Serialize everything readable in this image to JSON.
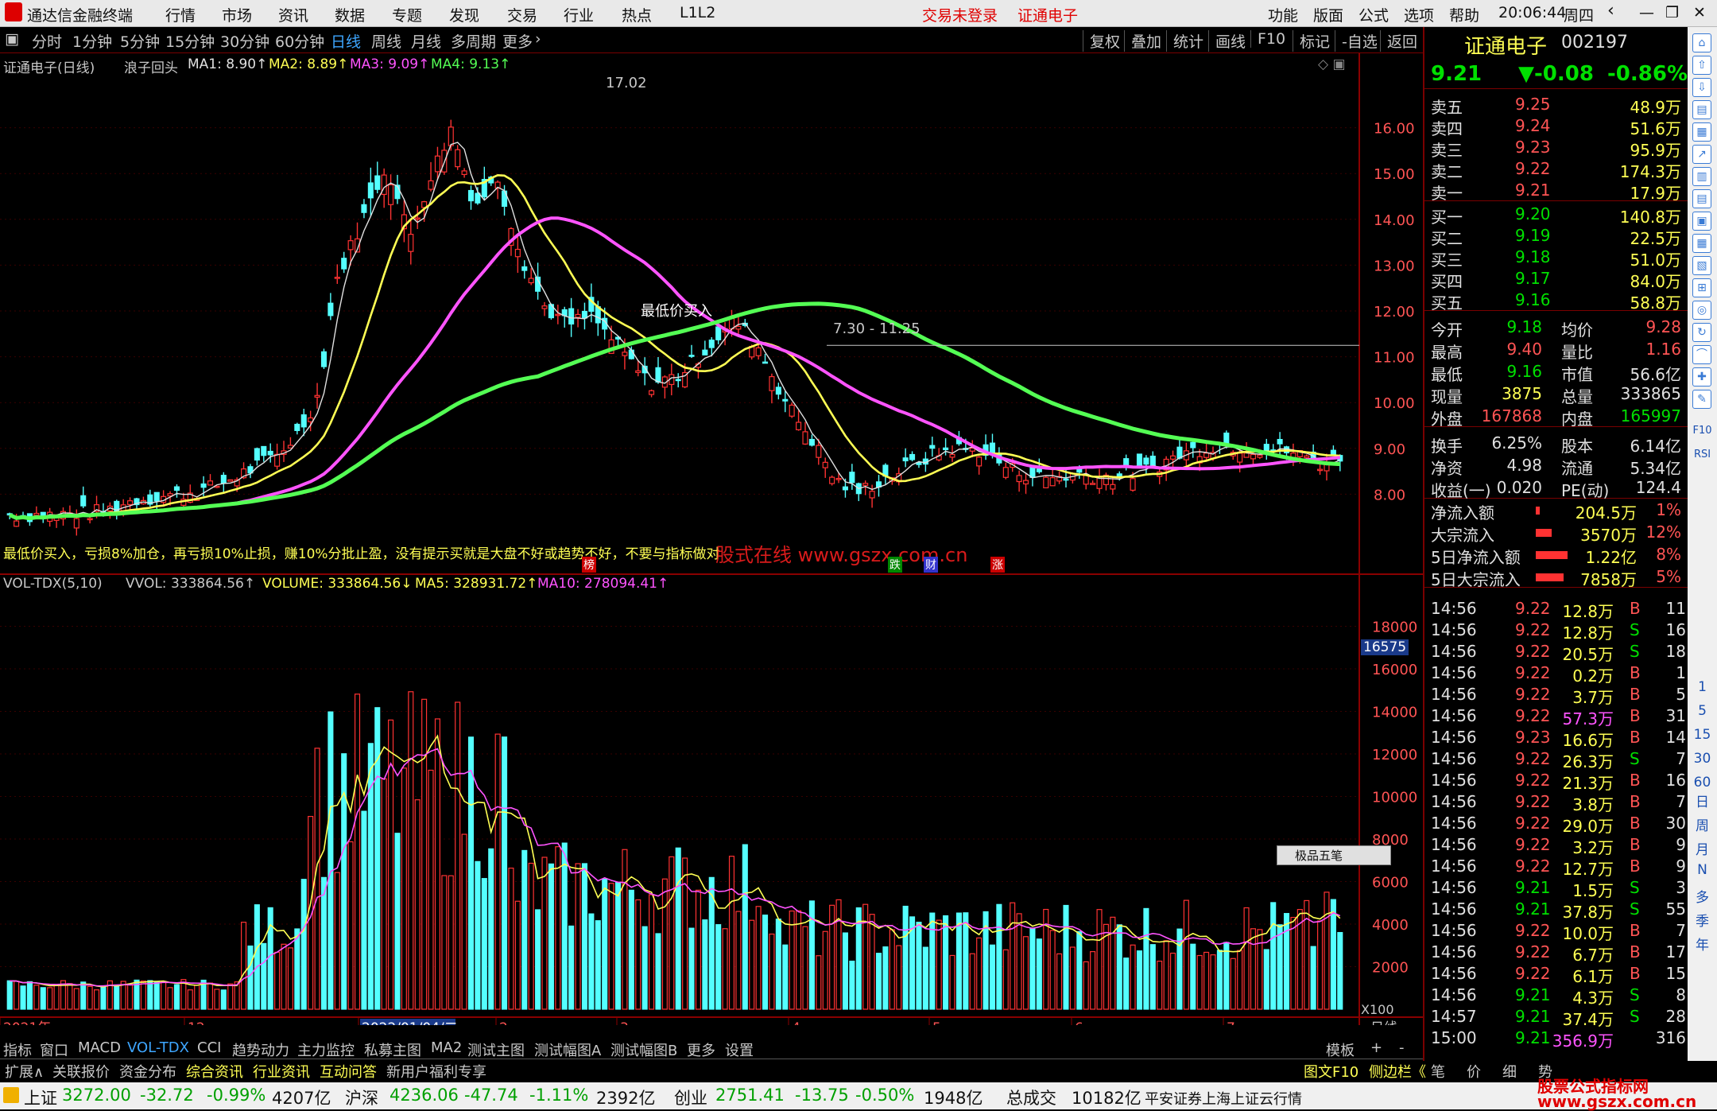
{
  "app": {
    "title": "通达信金融终端",
    "menus": [
      "行情",
      "市场",
      "资讯",
      "数据",
      "专题",
      "发现",
      "交易",
      "行业",
      "热点",
      "L1L2"
    ],
    "center_links": [
      "交易未登录",
      "证通电子"
    ],
    "right_menus": [
      "功能",
      "版面",
      "公式",
      "选项",
      "帮助"
    ],
    "clock": "20:06:44",
    "weekday": "周四"
  },
  "toolbar": {
    "periods": [
      "分时",
      "1分钟",
      "5分钟",
      "15分钟",
      "30分钟",
      "60分钟",
      "日线",
      "周线",
      "月线",
      "多周期",
      "更多"
    ],
    "active_period": "日线",
    "actions": [
      "复权",
      "叠加",
      "统计",
      "画线",
      "F10",
      "标记",
      "-自选",
      "返回"
    ]
  },
  "main_chart": {
    "header_name": "证通电子(日线)",
    "formula": "浪子回头",
    "ma1": "MA1: 8.90↑",
    "ma2": "MA2: 8.89↑",
    "ma3": "MA3: 9.09↑",
    "ma4": "MA4: 9.13↑",
    "peak_label": "17.02",
    "low_label": "7.30 - 11.25",
    "annotation": "最低价买入",
    "strategy_text": "最低价买入，亏损8%加仓，再亏损10%止损，赚10%分批止盈，没有提示买就是大盘不好或趋势不好，不要与指标做对",
    "watermark": "股式在线  www.gszx.com.cn",
    "badges": [
      "榜",
      "跌",
      "财",
      "涨"
    ],
    "price_ticks": [
      "16.00",
      "15.00",
      "14.00",
      "13.00",
      "12.00",
      "11.00",
      "10.00",
      "9.00",
      "8.00"
    ]
  },
  "volume_chart": {
    "header_name": "VOL-TDX(5,10)",
    "vvol": "VVOL: 333864.56↑",
    "volume": "VOLUME: 333864.56↓",
    "ma5": "MA5: 328931.72↑",
    "ma10": "MA10: 278094.41↑",
    "vol_ticks": [
      "18000",
      "16000",
      "14000",
      "12000",
      "10000",
      "8000",
      "6000",
      "4000",
      "2000"
    ],
    "cursor_value": "16575",
    "unit_label": "X100",
    "ime_label": "极品五笔"
  },
  "date_axis": {
    "labels": [
      "2021年",
      "12",
      "2022/01/04/二",
      "2",
      "3",
      "4",
      "5",
      "6",
      "7"
    ],
    "right_label": "日线"
  },
  "bottom_tabs": [
    "指标",
    "窗口",
    "MACD",
    "VOL-TDX",
    "CCI",
    "趋势动力",
    "主力监控",
    "私募主图",
    "MA2",
    "测试主图",
    "测试幅图A",
    "测试幅图B",
    "更多",
    "设置"
  ],
  "bottom_tabs_right": [
    "模板",
    "+",
    "-"
  ],
  "info_bar": [
    "扩展∧",
    "关联报价",
    "资金分布",
    "综合资讯",
    "行业资讯",
    "互动问答",
    "新用户福利专享"
  ],
  "info_bar_right": [
    "图文F10",
    "侧边栏《",
    "笔",
    "价",
    "细",
    "势"
  ],
  "stock": {
    "name": "证通电子",
    "code": "002197",
    "price": "9.21",
    "change": "▼-0.08",
    "pct": "-0.86%",
    "asks": [
      {
        "label": "卖五",
        "price": "9.25",
        "vol": "48.9万"
      },
      {
        "label": "卖四",
        "price": "9.24",
        "vol": "51.6万"
      },
      {
        "label": "卖三",
        "price": "9.23",
        "vol": "95.9万"
      },
      {
        "label": "卖二",
        "price": "9.22",
        "vol": "174.3万"
      },
      {
        "label": "卖一",
        "price": "9.21",
        "vol": "17.9万"
      }
    ],
    "bids": [
      {
        "label": "买一",
        "price": "9.20",
        "vol": "140.8万"
      },
      {
        "label": "买二",
        "price": "9.19",
        "vol": "22.5万"
      },
      {
        "label": "买三",
        "price": "9.18",
        "vol": "51.0万"
      },
      {
        "label": "买四",
        "price": "9.17",
        "vol": "84.0万"
      },
      {
        "label": "买五",
        "price": "9.16",
        "vol": "58.8万"
      }
    ],
    "stats": [
      {
        "l1": "今开",
        "v1": "9.18",
        "l2": "均价",
        "v2": "9.28"
      },
      {
        "l1": "最高",
        "v1": "9.40",
        "l2": "量比",
        "v2": "1.16"
      },
      {
        "l1": "最低",
        "v1": "9.16",
        "l2": "市值",
        "v2": "56.6亿"
      },
      {
        "l1": "现量",
        "v1": "3875",
        "l2": "总量",
        "v2": "333865"
      },
      {
        "l1": "外盘",
        "v1": "167868",
        "l2": "内盘",
        "v2": "165997"
      }
    ],
    "stats2": [
      {
        "l1": "换手",
        "v1": "6.25%",
        "l2": "股本",
        "v2": "6.14亿"
      },
      {
        "l1": "净资",
        "v1": "4.98",
        "l2": "流通",
        "v2": "5.34亿"
      },
      {
        "l1": "收益(一)",
        "v1": "0.020",
        "l2": "PE(动)",
        "v2": "124.4"
      }
    ],
    "flows": [
      {
        "label": "净流入额",
        "value": "204.5万",
        "pct": "1%",
        "bar": 0.03
      },
      {
        "label": "大宗流入",
        "value": "3570万",
        "pct": "12%",
        "bar": 0.45
      },
      {
        "label": "5日净流入额",
        "value": "1.22亿",
        "pct": "8%",
        "bar": 1.0
      },
      {
        "label": "5日大宗流入",
        "value": "7858万",
        "pct": "5%",
        "bar": 0.85
      }
    ],
    "ticks": [
      {
        "t": "14:56",
        "p": "9.22",
        "v": "12.8万",
        "d": "B",
        "n": "11"
      },
      {
        "t": "14:56",
        "p": "9.22",
        "v": "12.8万",
        "d": "S",
        "n": "16"
      },
      {
        "t": "14:56",
        "p": "9.22",
        "v": "20.5万",
        "d": "S",
        "n": "18"
      },
      {
        "t": "14:56",
        "p": "9.22",
        "v": "0.2万",
        "d": "B",
        "n": "1"
      },
      {
        "t": "14:56",
        "p": "9.22",
        "v": "3.7万",
        "d": "B",
        "n": "5"
      },
      {
        "t": "14:56",
        "p": "9.22",
        "v": "57.3万",
        "d": "B",
        "n": "31"
      },
      {
        "t": "14:56",
        "p": "9.23",
        "v": "16.6万",
        "d": "B",
        "n": "14"
      },
      {
        "t": "14:56",
        "p": "9.22",
        "v": "26.3万",
        "d": "S",
        "n": "7"
      },
      {
        "t": "14:56",
        "p": "9.22",
        "v": "21.3万",
        "d": "B",
        "n": "16"
      },
      {
        "t": "14:56",
        "p": "9.22",
        "v": "3.8万",
        "d": "B",
        "n": "7"
      },
      {
        "t": "14:56",
        "p": "9.22",
        "v": "29.0万",
        "d": "B",
        "n": "30"
      },
      {
        "t": "14:56",
        "p": "9.22",
        "v": "3.2万",
        "d": "B",
        "n": "9"
      },
      {
        "t": "14:56",
        "p": "9.22",
        "v": "12.7万",
        "d": "B",
        "n": "9"
      },
      {
        "t": "14:56",
        "p": "9.21",
        "v": "1.5万",
        "d": "S",
        "n": "3"
      },
      {
        "t": "14:56",
        "p": "9.21",
        "v": "37.8万",
        "d": "S",
        "n": "55"
      },
      {
        "t": "14:56",
        "p": "9.22",
        "v": "10.0万",
        "d": "B",
        "n": "7"
      },
      {
        "t": "14:56",
        "p": "9.22",
        "v": "6.7万",
        "d": "B",
        "n": "17"
      },
      {
        "t": "14:56",
        "p": "9.22",
        "v": "6.1万",
        "d": "B",
        "n": "15"
      },
      {
        "t": "14:56",
        "p": "9.21",
        "v": "4.3万",
        "d": "S",
        "n": "8"
      },
      {
        "t": "14:57",
        "p": "9.21",
        "v": "37.4万",
        "d": "S",
        "n": "28"
      },
      {
        "t": "15:00",
        "p": "9.21",
        "v": "356.9万",
        "d": "",
        "n": "316"
      }
    ]
  },
  "index_bar": [
    {
      "name": "上证",
      "value": "3272.00",
      "chg": "-32.72",
      "pct": "-0.99%",
      "amt": "4207亿"
    },
    {
      "name": "沪深",
      "value": "4236.06",
      "chg": "-47.74",
      "pct": "-1.11%",
      "amt": "2392亿"
    },
    {
      "name": "创业",
      "value": "2751.41",
      "chg": "-13.75",
      "pct": "-0.50%",
      "amt": "1948亿"
    }
  ],
  "total_turnover_label": "总成交",
  "total_turnover": "10182亿",
  "broker": "平安证券上海上证云行情",
  "brand_watermark": "股票公式指标网 www.gszx.com.cn",
  "side_icons": [
    "日",
    "周",
    "月",
    "N",
    "多",
    "季",
    "年",
    "1",
    "5",
    "15",
    "30",
    "60",
    "F10",
    "RSI"
  ]
}
